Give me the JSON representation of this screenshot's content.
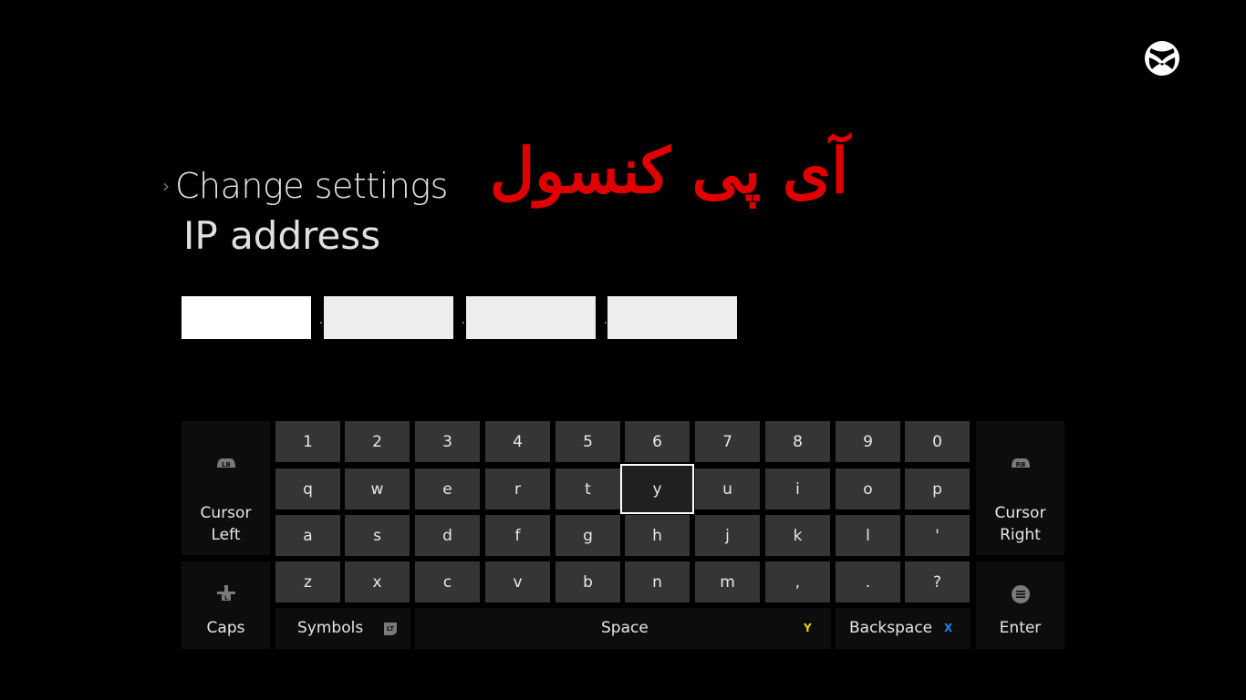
{
  "header": {
    "breadcrumb": "Change settings",
    "overlay_text": "آی پی کنسول",
    "title": "IP address",
    "logo_icon": "xbox-logo-icon"
  },
  "ip_fields": [
    {
      "value": "",
      "active": true
    },
    {
      "value": "",
      "active": false
    },
    {
      "value": "",
      "active": false
    },
    {
      "value": "",
      "active": false
    }
  ],
  "ip_separator": ".",
  "keyboard": {
    "rows": [
      [
        "1",
        "2",
        "3",
        "4",
        "5",
        "6",
        "7",
        "8",
        "9",
        "0"
      ],
      [
        "q",
        "w",
        "e",
        "r",
        "t",
        "y",
        "u",
        "i",
        "o",
        "p"
      ],
      [
        "a",
        "s",
        "d",
        "f",
        "g",
        "h",
        "j",
        "k",
        "l",
        "'"
      ],
      [
        "z",
        "x",
        "c",
        "v",
        "b",
        "n",
        "m",
        ",",
        ".",
        "?"
      ]
    ],
    "selected_key": "y",
    "cursor_left": {
      "label_line1": "Cursor",
      "label_line2": "Left",
      "hint": "LB",
      "icon": "lb-bumper-icon"
    },
    "cursor_right": {
      "label_line1": "Cursor",
      "label_line2": "Right",
      "hint": "RB",
      "icon": "rb-bumper-icon"
    },
    "caps": {
      "label": "Caps",
      "icon": "left-stick-icon"
    },
    "symbols": {
      "label": "Symbols",
      "hint": "LT",
      "icon": "lt-trigger-icon"
    },
    "space": {
      "label": "Space",
      "hint": "Y",
      "hint_color": "#f2d000"
    },
    "backspace": {
      "label": "Backspace",
      "hint": "X",
      "hint_color": "#1e88e5"
    },
    "enter": {
      "label": "Enter",
      "icon": "menu-button-icon"
    }
  }
}
